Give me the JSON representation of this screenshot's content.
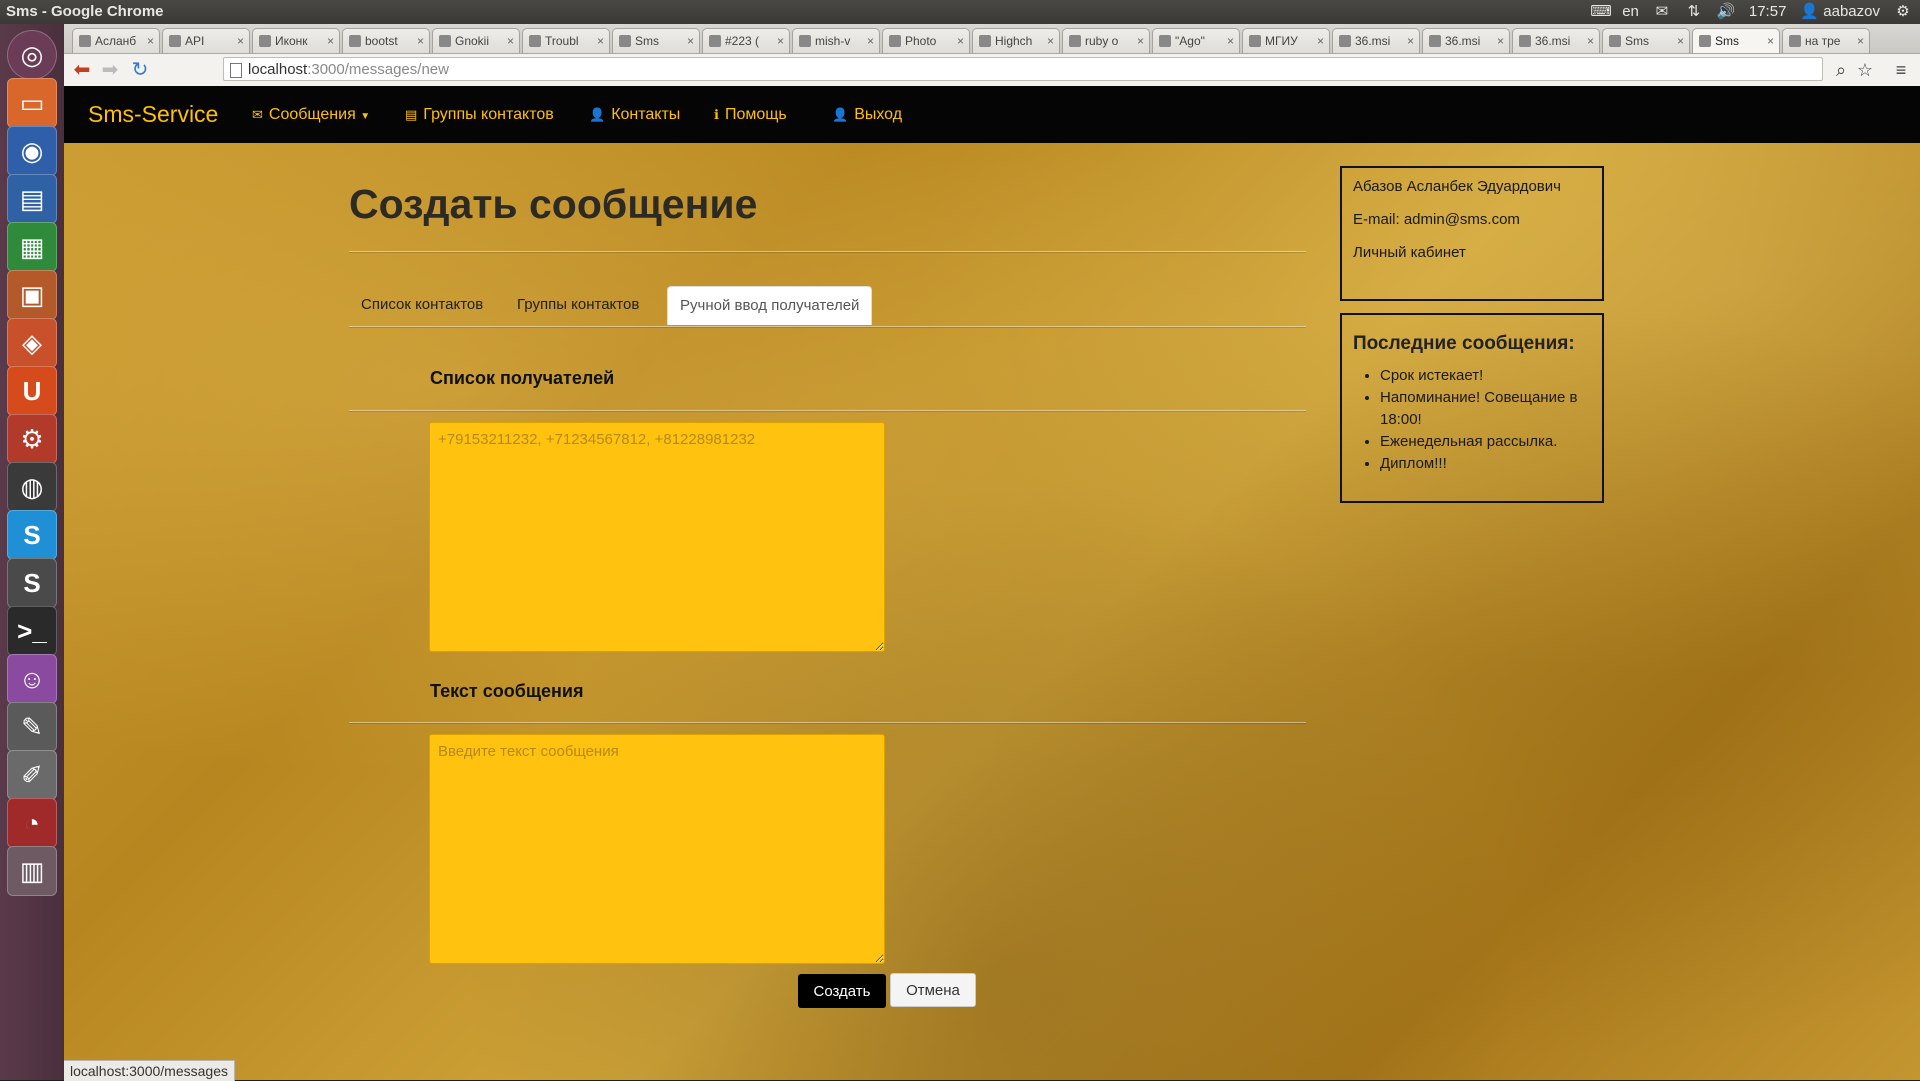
{
  "system": {
    "window_title": "Sms - Google Chrome",
    "keyboard_layout": "en",
    "time": "17:57",
    "user": "aabazov"
  },
  "browser": {
    "tabs": [
      {
        "label": "Асланб"
      },
      {
        "label": "API"
      },
      {
        "label": "Иконк"
      },
      {
        "label": "bootst"
      },
      {
        "label": "Gnokii"
      },
      {
        "label": "Troubl"
      },
      {
        "label": "Sms"
      },
      {
        "label": "#223 ("
      },
      {
        "label": "mish-v"
      },
      {
        "label": "Photo"
      },
      {
        "label": "Highch"
      },
      {
        "label": "ruby o"
      },
      {
        "label": "\"Ago\""
      },
      {
        "label": "МГИУ"
      },
      {
        "label": "36.msi"
      },
      {
        "label": "36.msi"
      },
      {
        "label": "36.msi"
      },
      {
        "label": "Sms"
      },
      {
        "label": "Sms"
      },
      {
        "label": "на тре"
      }
    ],
    "active_tab_index": 18,
    "url_host": "localhost",
    "url_path": ":3000/messages/new",
    "status_url": "localhost:3000/messages"
  },
  "navbar": {
    "brand": "Sms-Service",
    "items": [
      {
        "label": "Сообщения",
        "icon": "envelope-icon",
        "dropdown": true
      },
      {
        "label": "Группы контактов",
        "icon": "list-icon"
      },
      {
        "label": "Контакты",
        "icon": "user-icon"
      },
      {
        "label": "Помощь",
        "icon": "info-icon"
      },
      {
        "label": "Выход",
        "icon": "user-icon"
      }
    ]
  },
  "main": {
    "title": "Создать сообщение",
    "tabs": [
      {
        "label": "Список контактов"
      },
      {
        "label": "Группы контактов"
      },
      {
        "label": "Ручной ввод получателей"
      }
    ],
    "active_tab": 2,
    "recipients_heading": "Список получателей",
    "recipients_placeholder": "+79153211232, +71234567812, +81228981232",
    "message_heading": "Текст сообщения",
    "message_placeholder": "Введите текст сообщения",
    "create_button": "Создать",
    "cancel_button": "Отмена"
  },
  "sidebar": {
    "user_name": "Абазов Асланбек Эдуардович",
    "email_line": "E-mail: admin@sms.com",
    "profile_link": "Личный кабинет",
    "recent_heading": "Последние сообщения:",
    "recent_messages": [
      "Срок истекает!",
      "Напоминание! Совещание в 18:00!",
      "Еженедельная рассылка.",
      "Диплом!!!"
    ]
  },
  "colors": {
    "accent": "#ffc000",
    "navbar_bg": "#050505",
    "textarea_bg": "#ffc20e"
  }
}
